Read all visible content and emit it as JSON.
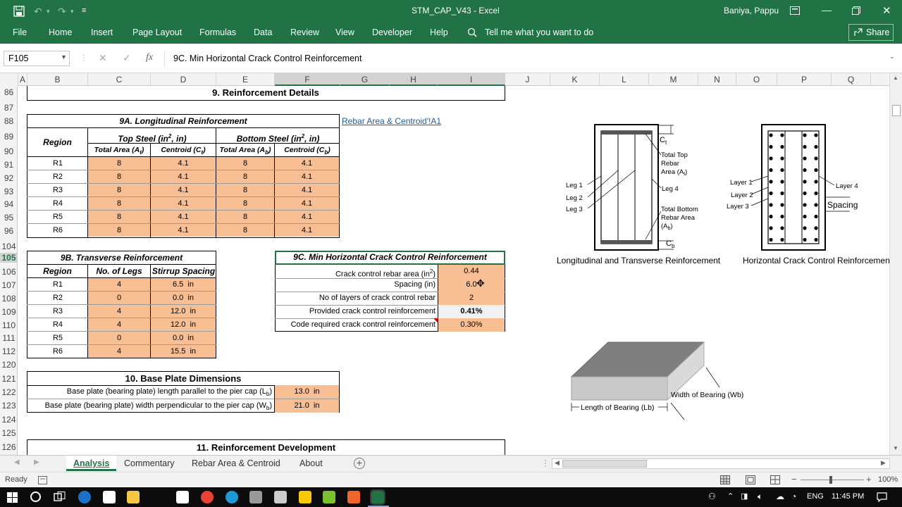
{
  "window": {
    "file_title": "STM_CAP_V43",
    "sep": "-",
    "app": "Excel",
    "user": "Baniya, Pappu"
  },
  "ribbon": {
    "tabs": [
      "File",
      "Home",
      "Insert",
      "Page Layout",
      "Formulas",
      "Data",
      "Review",
      "View",
      "Developer",
      "Help"
    ],
    "tell_me": "Tell me what you want to do",
    "share": "Share"
  },
  "formula_bar": {
    "name_box": "F105",
    "fx": "fx",
    "content": "9C. Min Horizontal Crack Control Reinforcement"
  },
  "columns": [
    "A",
    "B",
    "C",
    "D",
    "E",
    "F",
    "G",
    "H",
    "I",
    "J",
    "K",
    "L",
    "M",
    "N",
    "O",
    "P",
    "Q"
  ],
  "rows": [
    "86",
    "87",
    "88",
    "89",
    "90",
    "91",
    "92",
    "93",
    "94",
    "95",
    "96",
    "104",
    "105",
    "106",
    "107",
    "108",
    "109",
    "110",
    "111",
    "112",
    "120",
    "121",
    "122",
    "123",
    "124",
    "125",
    "126"
  ],
  "sheet": {
    "section9_title": "9. Reinforcement Details",
    "link": "Rebar Area & Centroid'!A1",
    "t9a": {
      "title": "9A. Longitudinal Reinforcement",
      "region_hdr": "Region",
      "top_hdr": "Top Steel (in",
      "top_hdr_sup": "2",
      "top_hdr_end": ", in)",
      "bot_hdr": "Bottom Steel (in",
      "bot_hdr_sup": "2",
      "bot_hdr_end": ", in)",
      "sub1": "Total Area (A",
      "sub1s": "t",
      "sub2": "Centroid (C",
      "sub2s": "t",
      "sub3": "Total Area (A",
      "sub3s": "b",
      "sub4": "Centroid (C",
      "sub4s": "b",
      "close": ")",
      "rows": [
        {
          "region": "R1",
          "ta": "8",
          "ct": "4.1",
          "ba": "8",
          "cb": "4.1"
        },
        {
          "region": "R2",
          "ta": "8",
          "ct": "4.1",
          "ba": "8",
          "cb": "4.1"
        },
        {
          "region": "R3",
          "ta": "8",
          "ct": "4.1",
          "ba": "8",
          "cb": "4.1"
        },
        {
          "region": "R4",
          "ta": "8",
          "ct": "4.1",
          "ba": "8",
          "cb": "4.1"
        },
        {
          "region": "R5",
          "ta": "8",
          "ct": "4.1",
          "ba": "8",
          "cb": "4.1"
        },
        {
          "region": "R6",
          "ta": "8",
          "ct": "4.1",
          "ba": "8",
          "cb": "4.1"
        }
      ]
    },
    "t9b": {
      "title": "9B. Transverse Reinforcement",
      "h1": "Region",
      "h2": "No. of Legs",
      "h3": "Stirrup Spacing",
      "rows": [
        {
          "region": "R1",
          "legs": "4",
          "sp": "6.5",
          "unit": "in"
        },
        {
          "region": "R2",
          "legs": "0",
          "sp": "0.0",
          "unit": "in"
        },
        {
          "region": "R3",
          "legs": "4",
          "sp": "12.0",
          "unit": "in"
        },
        {
          "region": "R4",
          "legs": "4",
          "sp": "12.0",
          "unit": "in"
        },
        {
          "region": "R5",
          "legs": "0",
          "sp": "0.0",
          "unit": "in"
        },
        {
          "region": "R6",
          "legs": "4",
          "sp": "15.5",
          "unit": "in"
        }
      ]
    },
    "t9c": {
      "title": "9C. Min Horizontal Crack Control Reinforcement",
      "r1_label": "Crack control rebar area (in",
      "r1_sup": "2",
      "r1_end": ")",
      "r1_val": "0.44",
      "r2_label": "Spacing (in)",
      "r2_val": "6.0",
      "r3_label": "No of layers of crack control rebar",
      "r3_val": "2",
      "r4_label": "Provided crack control reinforcement",
      "r4_val": "0.41%",
      "r5_label": "Code required crack control reinforcement",
      "r5_val": "0.30%"
    },
    "section10": {
      "title": "10. Base Plate Dimensions",
      "r1_label": "Base plate (bearing plate) length parallel to the pier cap (L",
      "r1_sub": "b",
      "r1_end": ")",
      "r1_val": "13.0",
      "r1_unit": "in",
      "r2_label": "Base plate (bearing plate) width perpendicular to the pier cap (W",
      "r2_sub": "b",
      "r2_end": ")",
      "r2_val": "21.0",
      "r2_unit": "in"
    },
    "section11_title": "11. Reinforcement Development",
    "fig1": {
      "ct": "C",
      "ct_sub": "t",
      "top_area_1": "Total Top",
      "top_area_2": "Rebar",
      "top_area_3": "Area (A",
      "top_area_3s": "t",
      "top_area_3e": ")",
      "leg1": "Leg 1",
      "leg2": "Leg 2",
      "leg3": "Leg 3",
      "leg4": "Leg 4",
      "bot_area_1": "Total Bottom",
      "bot_area_2": "Rebar Area",
      "bot_area_3": "(A",
      "bot_area_3s": "b",
      "bot_area_3e": ")",
      "cb": "C",
      "cb_sub": "b",
      "caption": "Longitudinal and Transverse Reinforcement"
    },
    "fig2": {
      "layer1": "Layer 1",
      "layer2": "Layer 2",
      "layer3": "Layer 3",
      "layer4": "Layer 4",
      "spacing": "Spacing",
      "caption": "Horizontal Crack Control Reinforcement"
    },
    "fig3": {
      "width": "Width of Bearing (Wb)",
      "length": "Length of Bearing (Lb)"
    }
  },
  "sheet_tabs": [
    "Analysis",
    "Commentary",
    "Rebar Area & Centroid",
    "About"
  ],
  "status": {
    "ready": "Ready",
    "zoom": "100%"
  },
  "taskbar": {
    "lang": "ENG",
    "time": "11:45 PM"
  },
  "colors": {
    "excel_green": "#217346",
    "cell_orange": "#f9bf94",
    "link_blue": "#1f5c9e"
  }
}
